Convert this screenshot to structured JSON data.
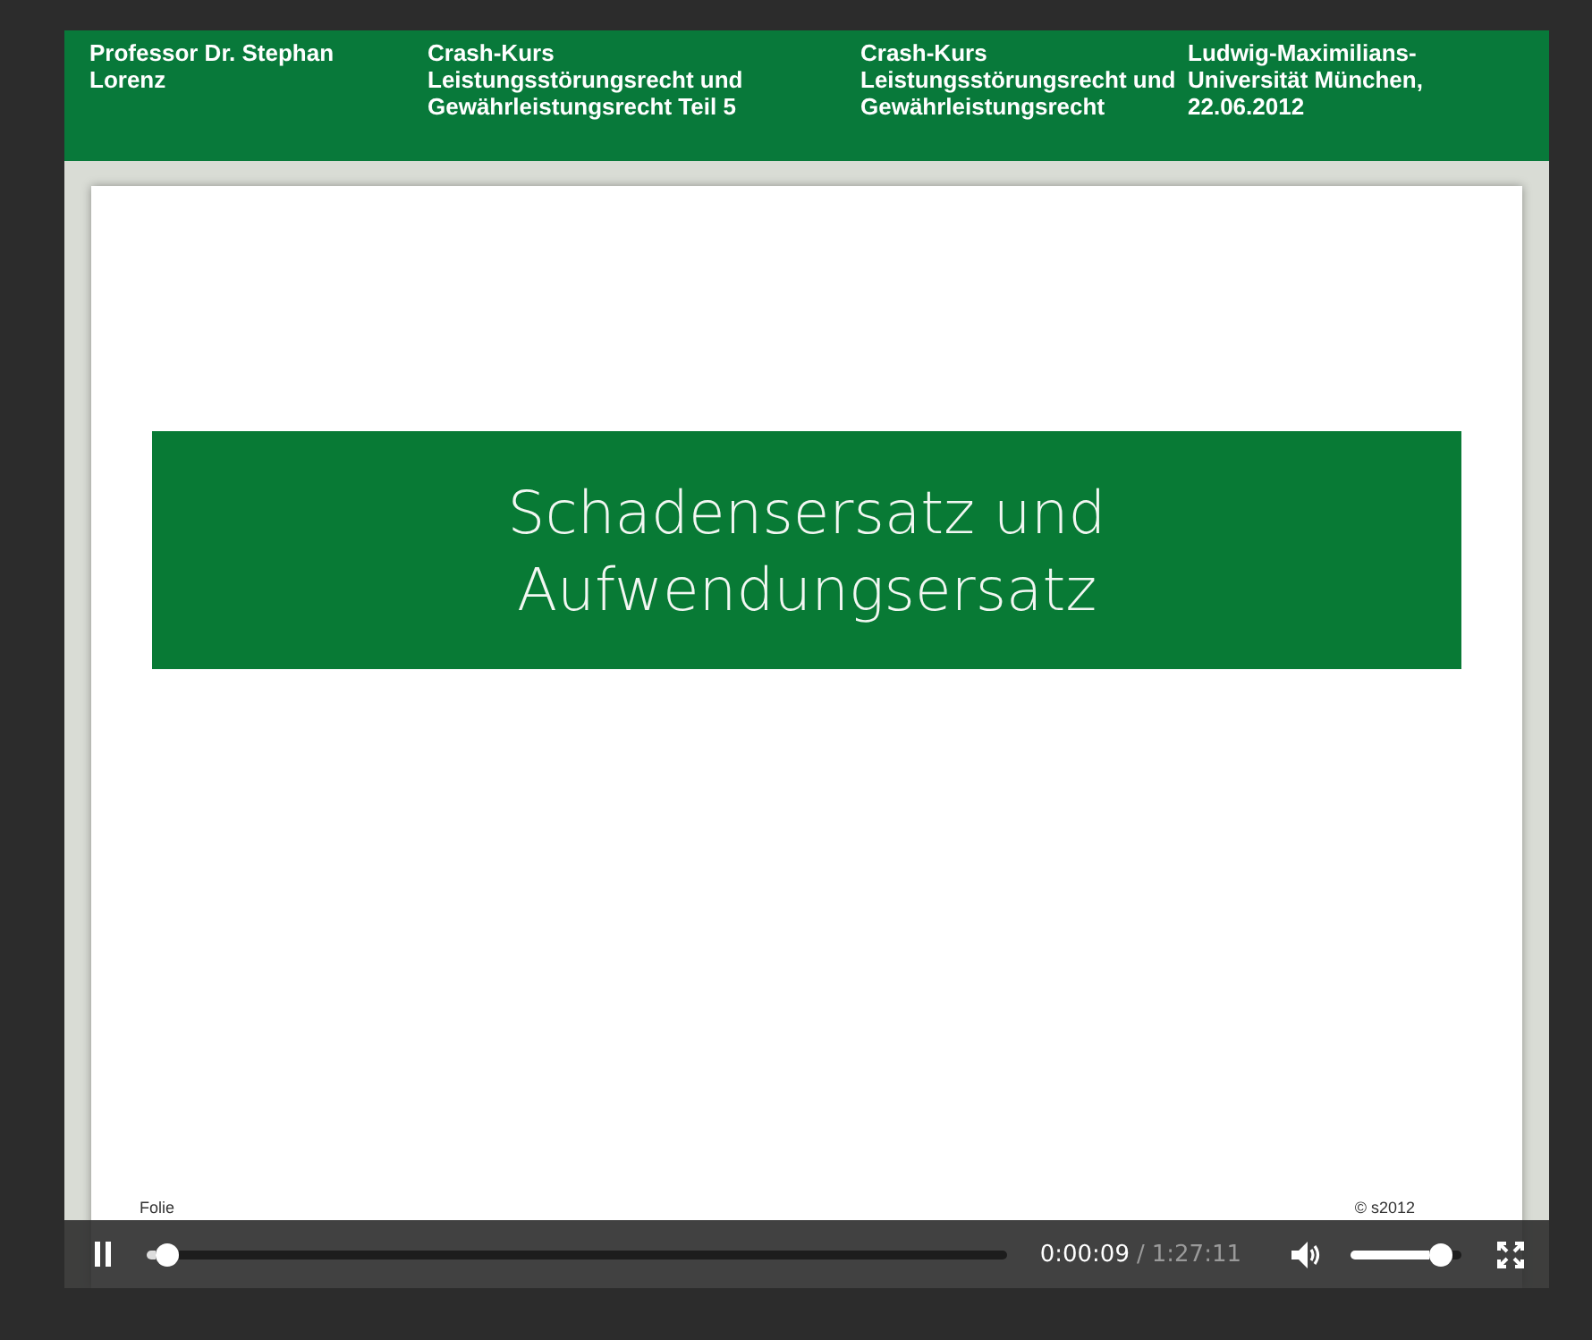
{
  "header": {
    "columns": [
      "Professor Dr. Stephan Lorenz",
      "Crash-Kurs Leistungsstörungsrecht und Gewährleistungsrecht Teil 5",
      "Crash-Kurs Leistungsstörungsrecht und Gewährleistungsrecht",
      "Ludwig-Maximilians-Universität München, 22.06.2012"
    ]
  },
  "slide": {
    "title_lines": [
      "Schadensersatz und",
      "Aufwendungsersatz"
    ],
    "footer_left": "Folie",
    "footer_right": "© s2012"
  },
  "player": {
    "playing": true,
    "progress": {
      "level": 0.01
    },
    "current_time": "0:00:09",
    "separator": "/",
    "duration": "1:27:11",
    "volume": {
      "level": 0.9,
      "muted": false
    }
  }
}
